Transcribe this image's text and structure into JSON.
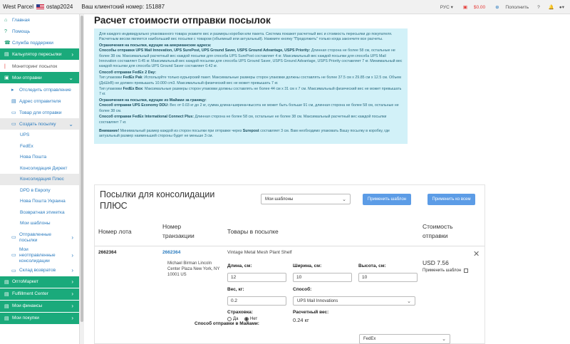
{
  "topbar": {
    "brand": "West Parcel",
    "username": "ostap2024",
    "client_number": "Ваш клиентский номер: 151887",
    "lang": "РУС",
    "balance": "$0.00",
    "topup": "Пополнить",
    "question": "?",
    "bell": "🔔"
  },
  "sidebar": {
    "items": [
      {
        "label": "Главная",
        "icon": "home-icon"
      },
      {
        "label": "Помощь",
        "icon": "help-icon"
      },
      {
        "label": "Служба поддержки",
        "icon": "support-icon"
      },
      {
        "label": "Кальулятор пересылки",
        "icon": "calculator-icon"
      },
      {
        "label": "Мониторинг посылок",
        "icon": "monitor-icon"
      },
      {
        "label": "Мои отправки",
        "icon": "box-icon"
      },
      {
        "label": "Отследить отправление",
        "icon": "track-icon"
      },
      {
        "label": "Адрес отправителя",
        "icon": "address-icon"
      },
      {
        "label": "Товар для отправки",
        "icon": "goods-icon"
      },
      {
        "label": "Создать посылку",
        "icon": "create-icon"
      },
      {
        "label": "UPS"
      },
      {
        "label": "FedEx"
      },
      {
        "label": "Нова Пошта"
      },
      {
        "label": "Консолидация Директ"
      },
      {
        "label": "Консолидация Плюс"
      },
      {
        "label": "DPD в Европу"
      },
      {
        "label": "Нова Пошта Украина"
      },
      {
        "label": "Возвратная этикетка"
      },
      {
        "label": "Мои шаблоны"
      },
      {
        "label": "Отправленные посылки"
      },
      {
        "label": "Мои неотправленные консолидации"
      },
      {
        "label": "Склад возвратов"
      },
      {
        "label": "OптоMаркет"
      },
      {
        "label": "Fulfillment Center"
      },
      {
        "label": "Мои финансы"
      },
      {
        "label": "Мои покупки"
      }
    ]
  },
  "page": {
    "title": "Расчет стоимости отправки посылок"
  },
  "info": {
    "intro": "Для каждого индивидуально упакованного товара укажите вес и размеры коробки или пакета. Система покажет расчетный вес и стоимость пересылки до покупателя. Расчетным весом является наибольший вес посылки с товаром (объемный или актуальный). Нажмите кнопку \"Продолжить\" только когда закончите все расчеты.",
    "us_heading": "Ограничения на посылки, идущие на американские адреса:",
    "us_methods_label": "Способы отправки UPS Mail Innovation, UPS SurePost, UPS Ground Saver, USPS Ground Advantage, USPS Priority:",
    "us_methods_text": "Длинная сторона не более 58 см, остальные не более 38 см. Максимальный расчетный вес каждой посылки для способа UPS SurePost составляет 4 кг. Максимальный вес каждой посылки для способа UPS Mail Innovation составляет 0.45 кг. Максимальный вес каждой посылки для способа UPS Ground Saver, USPS Ground Advantage, USPS Priority составляет 7 кг. Минимальный вес каждой посылки для способа UPS Ground Saver составляет 0.42 кг.",
    "fedex_heading": "Способ отправки FedEx 2 Day:",
    "fedex_pak_label": "FedEx Pak",
    "fedex_pak_prefix": "Тип упаковки",
    "fedex_pak_text": ": Используйте только курьерский пакет. Максимальные размеры сторон упаковки должны составлять не более 37.5 см х 29.85 см х 12.5 см. Объем (ДхШхВ) не должен превышать 10.000 cm3. Максимальный физический вес не может превышать 7 кг.",
    "fedex_box_prefix": "Тип упаковки",
    "fedex_box_label": "FedEx Box",
    "fedex_box_text": ": Максимальные размеры сторон упаковки должны составлять не более 44 см х 31 см х 7 см. Максимальный физический вес не может превышать 7 кг.",
    "intl_heading": "Ограничения на посылки, идущие из Майами за границу:",
    "ddu_label": "Способ отправки UPS Economy DDU:",
    "ddu_text": "Вес от 0.03 кг до 2 кг, сумма длина+ширина+высота не может быть больше 91 см, длинная сторона не более 58 см, остальные не более 38 см.",
    "fic_label": "Способ отправки FedEx International Connect Plus:",
    "fic_text": "Длинная сторона не более 58 см, остальные не более 38 см. Максимальный расчетный вес каждой посылки составляет 7 кг.",
    "attention_label": "Внимание!",
    "attention_text1": "Минимальный размер каждой из сторон посылки при отправке через",
    "attention_surepost": "Surepost",
    "attention_text2": "составляет 3 см. Вам необходимо упаковать Вашу посылку в коробку, где актуальный размер наименьшей стороны будет не меньше 3 см."
  },
  "panel": {
    "title": "Посылки для консолидации ПЛЮС",
    "template_select": "Мои шаблоны",
    "apply_template": "Применить шаблон",
    "apply_all": "Применить ко всем",
    "columns": {
      "lot": "Номер лота",
      "tracking": "Номер транзакции",
      "items": "Товары в посылке",
      "cost": "Стоимость отправки"
    },
    "row": {
      "lot": "2662364",
      "tracking": "2662364",
      "address": "Michael Birman Lincoln Center Plaza New York, NY 10001 US",
      "product": "Vintage Metal Mesh Plant Shelf",
      "length_label": "Длина, см:",
      "length": "12",
      "width_label": "Ширина, см:",
      "width": "10",
      "height_label": "Высота, см:",
      "height": "10",
      "weight_label": "Вес, кг:",
      "weight": "0.2",
      "method_label": "Способ:",
      "method": "UPS Mail Innovations",
      "insurance_label": "Страховка:",
      "yes": "Да",
      "no": "Нет",
      "calc_weight_label": "Расчетный вес:",
      "calc_weight": "0.24 кг",
      "price": "USD 7.56",
      "apply_template_label": "Применить шаблон"
    },
    "miami_label": "Способ отправки в Майами:",
    "miami_method": "FedEx"
  }
}
